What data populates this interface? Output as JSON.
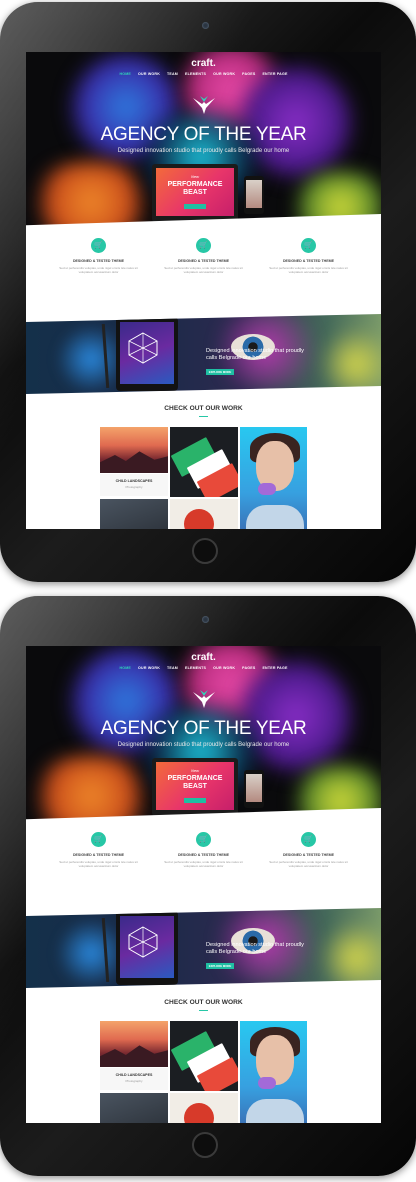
{
  "brand": {
    "accent": "#27c7a6",
    "hero_bg": "#0a0a0c"
  },
  "site": {
    "logo": "craft.",
    "nav": [
      {
        "label": "HOME",
        "active": true
      },
      {
        "label": "OUR WORK",
        "active": false
      },
      {
        "label": "TEAM",
        "active": false
      },
      {
        "label": "ELEMENTS",
        "active": false
      },
      {
        "label": "OUR WORK",
        "active": false
      },
      {
        "label": "PAGES",
        "active": false
      },
      {
        "label": "ENTER PAGE",
        "active": false
      }
    ],
    "hero": {
      "headline": "AGENCY OF THE YEAR",
      "subheadline": "Designed innovation studio that proudly calls Belgrade our home",
      "device_small": "New",
      "device_title": "PERFORMANCE BEAST"
    },
    "features": [
      {
        "icon": "cart-icon",
        "title": "DESIGNED & TESTED THEME",
        "text": "Sed ut perferendis voluptas, unde nigel omnis iste natus sit voluptatem accusantium dolor"
      },
      {
        "icon": "cart-icon",
        "title": "DESIGNED & TESTED THEME",
        "text": "Sed ut perferendis voluptas, unde nigel omnis iste natus sit voluptatem accusantium dolor"
      },
      {
        "icon": "cart-icon",
        "title": "DESIGNED & TESTED THEME",
        "text": "Sed ut perferendis voluptas, unde nigel omnis iste natus sit voluptatem accusantium dolor"
      }
    ],
    "banner": {
      "text": "Designed innovation studio that proudly calls Belgrade our home",
      "button": "EXPLORE MORE"
    },
    "work": {
      "title": "CHECK OUT OUR WORK",
      "items": [
        {
          "title": "CHILD LANDSCAPES",
          "category": "Photography"
        }
      ]
    }
  }
}
